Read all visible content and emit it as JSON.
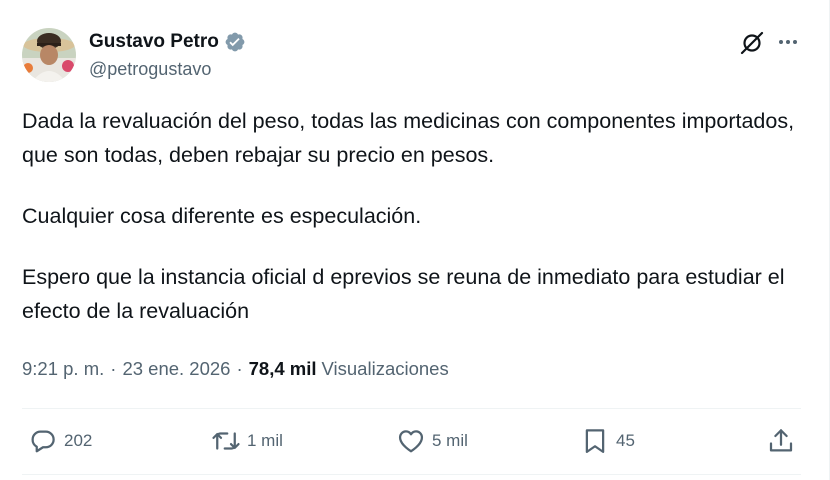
{
  "author": {
    "name": "Gustavo Petro",
    "handle": "@petrogustavo",
    "verified": true
  },
  "header_icons": [
    "grok-icon",
    "more-icon"
  ],
  "tweet": {
    "paragraphs": [
      "Dada la revaluación del peso, todas las medicinas con componentes importados, que son todas, deben rebajar su precio en pesos.",
      "Cualquier cosa diferente es especulación.",
      "Espero que la instancia oficial d eprevios se reuna de inmediato para estudiar el efecto de la revaluación"
    ]
  },
  "meta": {
    "time": "9:21 p. m.",
    "separator": "·",
    "date": "23 ene. 2026",
    "views_count": "78,4 mil",
    "views_label": "Visualizaciones"
  },
  "actions": {
    "replies": "202",
    "reposts": "1 mil",
    "likes": "5 mil",
    "bookmarks": "45"
  },
  "colors": {
    "text": "#0f1419",
    "secondary": "#536471",
    "verified": "#829aab",
    "divider": "#eff3f4"
  }
}
